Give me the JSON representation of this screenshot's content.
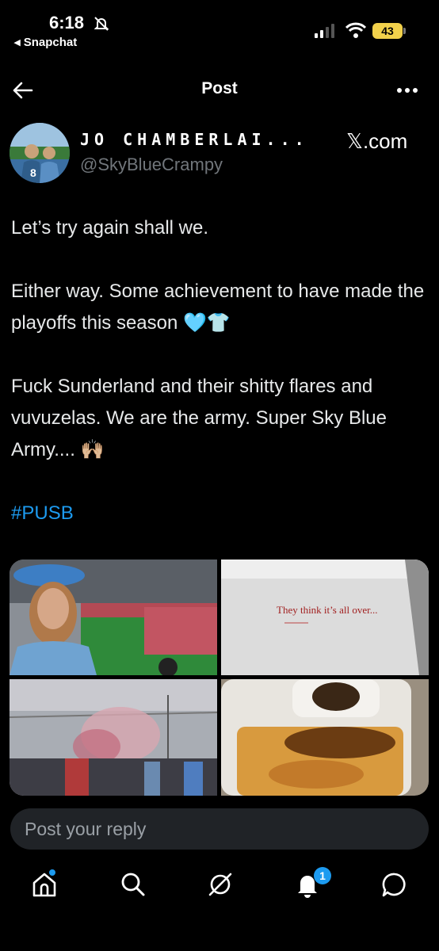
{
  "status_bar": {
    "time": "6:18",
    "back_app": "◂ Snapchat",
    "battery": "43"
  },
  "header": {
    "title": "Post"
  },
  "author": {
    "display_name": "JO CHAMBERLAI...",
    "handle": "@SkyBlueCrampy",
    "source": "𝕏.com"
  },
  "post": {
    "lines": [
      "Let’s try again shall we.",
      "Either way. Some achievement to have made the playoffs this season 🩵👕",
      "Fuck Sunderland and their shitty flares and vuvuzelas. We are the army. Super Sky Blue Army.... 🙌🏼"
    ],
    "hashtag": "#PUSB"
  },
  "media": {
    "wall_text": "They think it’s all over..."
  },
  "reply": {
    "placeholder": "Post your reply"
  },
  "nav": {
    "notifications_badge": "1",
    "icons": [
      "home-icon",
      "search-icon",
      "grok-icon",
      "notifications-icon",
      "messages-icon"
    ]
  },
  "colors": {
    "accent": "#1d9bf0",
    "background": "#000000",
    "battery": "#f2d14b"
  }
}
